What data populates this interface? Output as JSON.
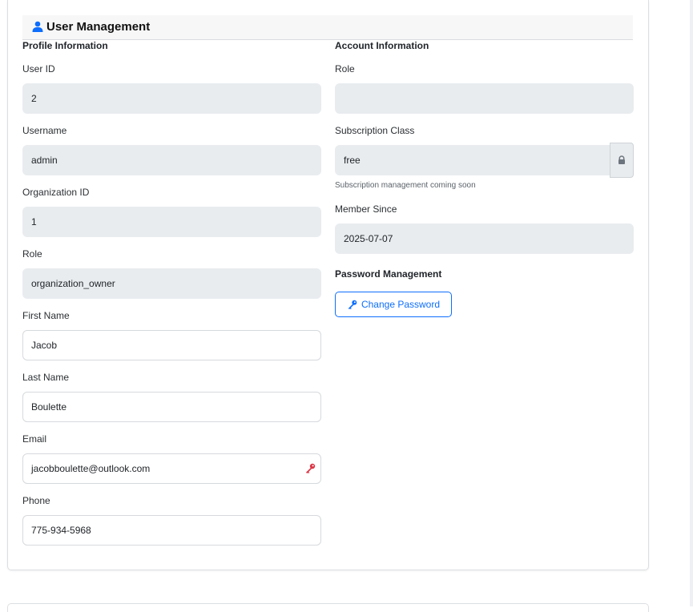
{
  "header": {
    "title": "User Management",
    "icon": "user-icon"
  },
  "profile": {
    "section_title": "Profile Information",
    "user_id": {
      "label": "User ID",
      "value": "2"
    },
    "username": {
      "label": "Username",
      "value": "admin"
    },
    "organization_id": {
      "label": "Organization ID",
      "value": "1"
    },
    "role": {
      "label": "Role",
      "value": "organization_owner"
    },
    "first_name": {
      "label": "First Name",
      "value": "Jacob"
    },
    "last_name": {
      "label": "Last Name",
      "value": "Boulette"
    },
    "email": {
      "label": "Email",
      "value": "jacobboulette@outlook.com",
      "icon": "key-icon",
      "icon_color": "#dc3545"
    },
    "phone": {
      "label": "Phone",
      "value": "775-934-5968"
    }
  },
  "account": {
    "section_title": "Account Information",
    "role": {
      "label": "Role",
      "value": ""
    },
    "subscription": {
      "label": "Subscription Class",
      "value": "free",
      "icon": "lock-icon",
      "help": "Subscription management coming soon"
    },
    "member_since": {
      "label": "Member Since",
      "value": "2025-07-07"
    },
    "password": {
      "section_title": "Password Management",
      "button_label": "Change Password",
      "icon": "key-icon"
    }
  },
  "colors": {
    "accent": "#0d6efd",
    "readonly_bg": "#e9ecef",
    "danger": "#dc3545"
  }
}
